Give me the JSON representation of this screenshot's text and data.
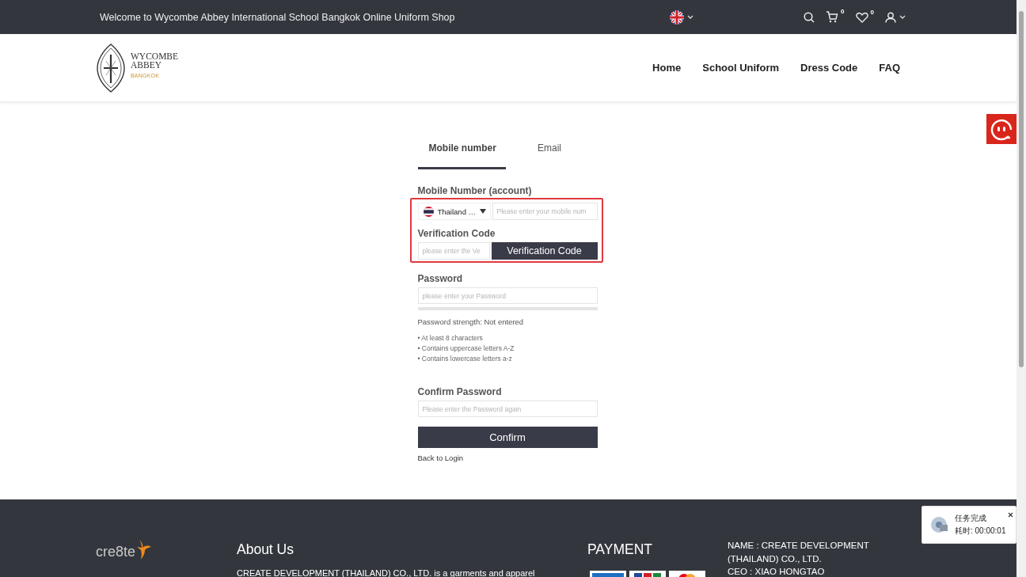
{
  "top_bar": {
    "welcome": "Welcome to Wycombe Abbey International School Bangkok Online Uniform Shop",
    "cart_count": "0",
    "wishlist_count": "0"
  },
  "header": {
    "logo": {
      "line1": "WYCOMBE",
      "line2": "ABBEY",
      "line3": "BANGKOK"
    },
    "nav": [
      {
        "label": "Home"
      },
      {
        "label": "School Uniform"
      },
      {
        "label": "Dress Code"
      },
      {
        "label": "FAQ"
      }
    ]
  },
  "form": {
    "tabs": [
      {
        "label": "Mobile number",
        "selected": true
      },
      {
        "label": "Email",
        "selected": false
      }
    ],
    "mobile": {
      "label": "Mobile Number (account)",
      "country": "Thailand …",
      "placeholder": "Please enter your mobile num"
    },
    "verification": {
      "label": "Verification Code",
      "placeholder": "please enter the Ve",
      "button": "Verification Code"
    },
    "password": {
      "label": "Password",
      "placeholder": "please enter your Password",
      "level": 0,
      "strength": "Password strength: Not entered",
      "rules": [
        "• At least 8 characters",
        "• Contains uppercase letters A-Z",
        "• Contains lowercase letters a-z"
      ]
    },
    "confirm_password": {
      "label": "Confirm Password",
      "placeholder": "Please enter the Password again"
    },
    "confirm_button": "Confirm",
    "back_link": "Back to Login"
  },
  "footer": {
    "logo": "cre8te",
    "about_title": "About Us",
    "about_text": "CREATE  DEVELOPMENT (THAILAND) CO., LTD.  is a garments and apparel",
    "payment_title": "PAYMENT",
    "company": [
      "NAME : CREATE DEVELOPMENT (THAILAND) CO., LTD.",
      "CEO : XIAO HONGTAO"
    ]
  },
  "notification": {
    "title": "任务完成",
    "time": "耗时: 00:00:01"
  }
}
